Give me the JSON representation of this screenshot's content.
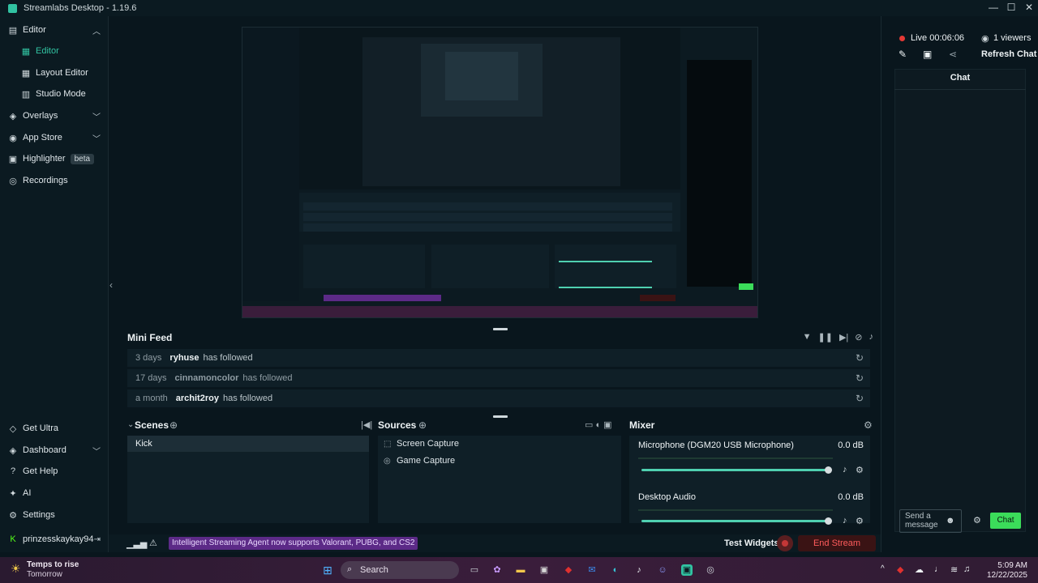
{
  "window": {
    "title": "Streamlabs Desktop - 1.19.6",
    "controls": [
      "—",
      "☐",
      "✕"
    ]
  },
  "sidebar": {
    "editor_group": "Editor",
    "items": [
      {
        "label": "Editor",
        "icon": "editor-icon"
      },
      {
        "label": "Layout Editor",
        "icon": "layout-icon"
      },
      {
        "label": "Studio Mode",
        "icon": "studio-icon"
      }
    ],
    "overlays": "Overlays",
    "app_store": "App Store",
    "highlighter": "Highlighter",
    "highlighter_badge": "beta",
    "recordings": "Recordings",
    "get_ultra": "Get Ultra",
    "dashboard": "Dashboard",
    "get_help": "Get Help",
    "ai": "AI",
    "settings": "Settings",
    "username": "prinzesskaykay94"
  },
  "mini_feed": {
    "title": "Mini Feed",
    "rows": [
      {
        "time": "3 days",
        "name": "ryhuse",
        "action": "has followed"
      },
      {
        "time": "17 days",
        "name": "cinnamoncolor",
        "action": "has followed"
      },
      {
        "time": "a month",
        "name": "archit2roy",
        "action": "has followed"
      }
    ]
  },
  "scenes": {
    "title": "Scenes",
    "items": [
      "Kick"
    ]
  },
  "sources": {
    "title": "Sources",
    "items": [
      {
        "label": "Screen Capture"
      },
      {
        "label": "Game Capture"
      }
    ]
  },
  "mixer": {
    "title": "Mixer",
    "channels": [
      {
        "name": "Microphone (DGM20 USB Microphone)",
        "db": "0.0 dB",
        "level": 1.0
      },
      {
        "name": "Desktop Audio",
        "db": "0.0 dB",
        "level": 1.0
      }
    ]
  },
  "footer": {
    "announcement": "Intelligent Streaming Agent now supports Valorant, PUBG, and CS2",
    "test_widgets": "Test Widgets",
    "end_stream": "End Stream"
  },
  "right_pane": {
    "live": "Live 00:06:06",
    "viewers": "1 viewers",
    "refresh_chat": "Refresh Chat",
    "chat_title": "Chat",
    "send_placeholder": "Send a message",
    "chat_button": "Chat"
  },
  "taskbar": {
    "weather_temp": "Temps to rise",
    "weather_sub": "Tomorrow",
    "search": "Search",
    "time": "5:09 AM",
    "date": "12/22/2025"
  },
  "colors": {
    "accent": "#31c3a2",
    "live": "#e53935",
    "chat_button": "#3bdc5a",
    "end_stream": "#ff5c5c"
  }
}
